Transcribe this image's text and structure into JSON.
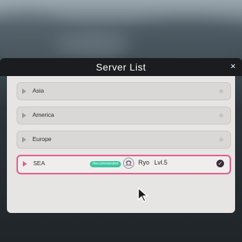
{
  "dialog": {
    "title": "Server List",
    "close_glyph": "×"
  },
  "servers": [
    {
      "name": "Asia",
      "selected": false
    },
    {
      "name": "America",
      "selected": false
    },
    {
      "name": "Europe",
      "selected": false
    },
    {
      "name": "SEA",
      "selected": true,
      "badge": "Recommended",
      "player": {
        "name": "Ryo",
        "level": "Lvl.5"
      }
    }
  ],
  "colors": {
    "selected_border": "#d9628f",
    "badge_bg": "#3cc59f",
    "header_bg": "#1a1c1f",
    "panel_bg": "#e6e5e3"
  },
  "icons": {
    "close": "close-icon",
    "row_arrow": "play-arrow-icon",
    "selected_check": "check-circle-icon",
    "cursor": "mouse-pointer-icon"
  }
}
